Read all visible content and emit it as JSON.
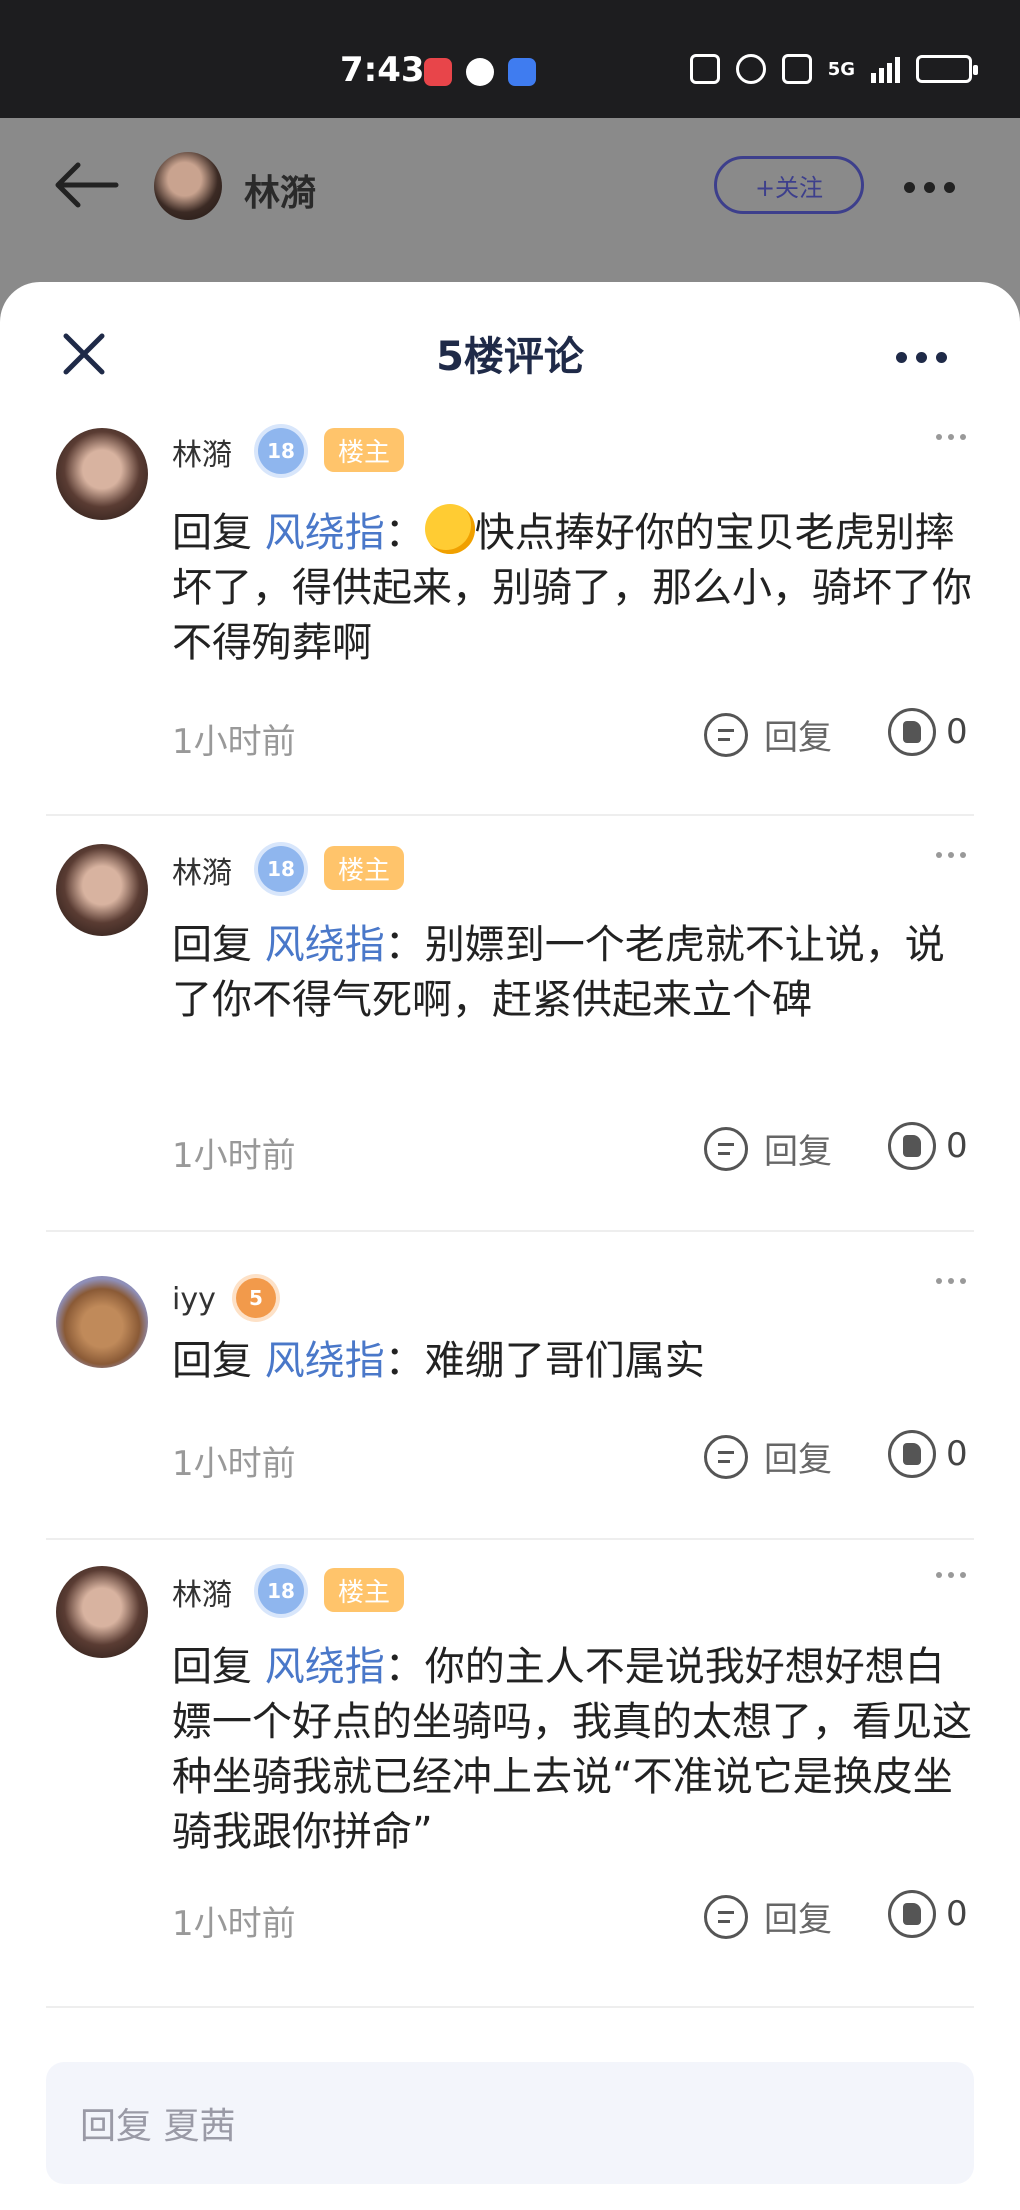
{
  "status_bar": {
    "time": "7:43",
    "network": "5G"
  },
  "header": {
    "name": "林漪",
    "follow_label": "+关注"
  },
  "sheet": {
    "title": "5楼评论"
  },
  "comments": [
    {
      "name": "林漪",
      "level": "18",
      "badge": "楼主",
      "reply_prefix": "回复 ",
      "reply_to": "风绕指",
      "separator": "：",
      "text": "快点捧好你的宝贝老虎别摔坏了，得供起来，别骑了，那么小，骑坏了你不得殉葬啊",
      "time": "1小时前",
      "reply_label": "回复",
      "likes": "0"
    },
    {
      "name": "林漪",
      "level": "18",
      "badge": "楼主",
      "reply_prefix": "回复 ",
      "reply_to": "风绕指",
      "separator": "：",
      "text": "别嫖到一个老虎就不让说，说了你不得气死啊，赶紧供起来立个碑",
      "time": "1小时前",
      "reply_label": "回复",
      "likes": "0"
    },
    {
      "name": "iyy",
      "level": "5",
      "reply_prefix": "回复 ",
      "reply_to": "风绕指",
      "separator": "：",
      "text": "难绷了哥们属实",
      "time": "1小时前",
      "reply_label": "回复",
      "likes": "0"
    },
    {
      "name": "林漪",
      "level": "18",
      "badge": "楼主",
      "reply_prefix": "回复 ",
      "reply_to": "风绕指",
      "separator": "：",
      "text": "你的主人不是说我好想好想白嫖一个好点的坐骑吗，我真的太想了，看见这种坐骑我就已经冲上去说“不准说它是换皮坐骑我跟你拼命”",
      "time": "1小时前",
      "reply_label": "回复",
      "likes": "0"
    }
  ],
  "input": {
    "placeholder": "回复 夏茜"
  }
}
